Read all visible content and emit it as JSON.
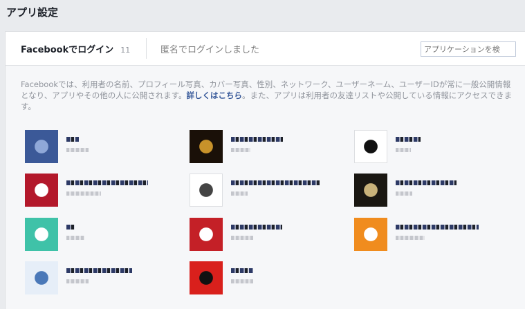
{
  "page": {
    "title": "アプリ設定"
  },
  "tabs": {
    "facebook_login": {
      "label": "Facebookでログイン",
      "count": "11"
    },
    "anonymous_login": {
      "label": "匿名でログインしました"
    }
  },
  "search": {
    "placeholder": "アプリケーションを検"
  },
  "description": {
    "text_before": "Facebookでは、利用者の名前、プロフィール写真、カバー写真、性別、ネットワーク、ユーザーネーム、ユーザーIDが常に一般公開情報となり、アプリやその他の人に公開されます。",
    "link": "詳しくはこちら",
    "text_after": "。また、アプリは利用者の友達リストや公開している情報にアクセスできます。"
  },
  "apps": [
    {
      "icon_color": "#3b5998",
      "icon_accent": "#8fa8d8",
      "icon": "blue-face-icon"
    },
    {
      "icon_color": "#1a1008",
      "icon_accent": "#c8922a",
      "icon": "dark-game-icon"
    },
    {
      "icon_color": "#ffffff",
      "icon_accent": "#111111",
      "icon": "outline-square-icon"
    },
    {
      "icon_color": "#b3182b",
      "icon_accent": "#ffffff",
      "icon": "red-banner-icon"
    },
    {
      "icon_color": "#ffffff",
      "icon_accent": "#444444",
      "icon": "gray-figure-icon"
    },
    {
      "icon_color": "#1a1712",
      "icon_accent": "#c9b27a",
      "icon": "dark-creature-icon"
    },
    {
      "icon_color": "#3fc2a8",
      "icon_accent": "#ffffff",
      "icon": "teal-bracket-icon"
    },
    {
      "icon_color": "#c42027",
      "icon_accent": "#ffffff",
      "icon": "red-stripes-icon"
    },
    {
      "icon_color": "#f08c1e",
      "icon_accent": "#ffffff",
      "icon": "orange-letter-icon"
    },
    {
      "icon_color": "#e6eef8",
      "icon_accent": "#4a78b8",
      "icon": "blue-checkmark-icon"
    },
    {
      "icon_color": "#d9201c",
      "icon_accent": "#111111",
      "icon": "red-character-icon"
    }
  ]
}
